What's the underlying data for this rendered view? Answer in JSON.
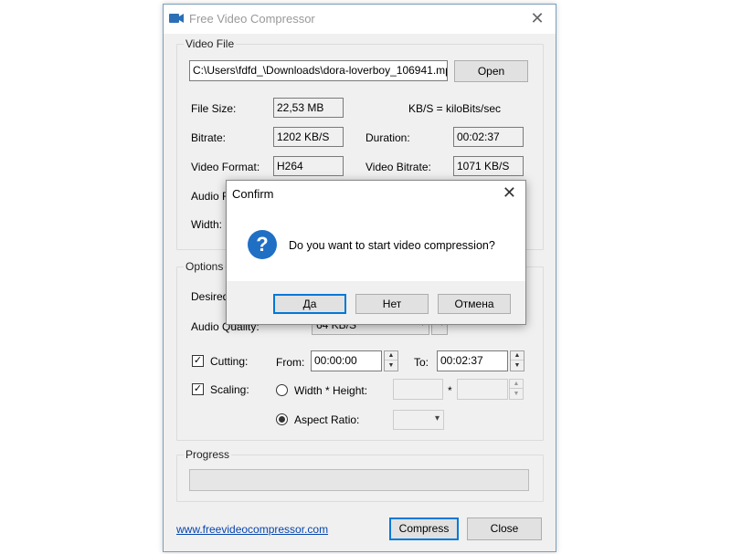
{
  "window": {
    "title": "Free Video Compressor",
    "close_glyph": "✕"
  },
  "video_file": {
    "group_label": "Video File",
    "path_value": "C:\\Users\\fdfd_\\Downloads\\dora-loverboy_106941.mp",
    "open_label": "Open",
    "file_size_label": "File Size:",
    "file_size_value": "22,53 MB",
    "units_note": "KB/S = kiloBits/sec",
    "bitrate_label": "Bitrate:",
    "bitrate_value": "1202 KB/S",
    "duration_label": "Duration:",
    "duration_value": "00:02:37",
    "video_format_label": "Video Format:",
    "video_format_value": "H264",
    "video_bitrate_label": "Video Bitrate:",
    "video_bitrate_value": "1071 KB/S",
    "audio_label_partial": "Audio F",
    "width_label": "Width:"
  },
  "options": {
    "group_label": "Options",
    "desired_label_partial": "Desired",
    "audio_quality_label": "Audio Quality:",
    "audio_quality_value": "64 KB/S",
    "cutting_label": "Cutting:",
    "cutting_checked": "✓",
    "from_label": "From:",
    "from_value": "00:00:00",
    "to_label": "To:",
    "to_value": "00:02:37",
    "scaling_label": "Scaling:",
    "scaling_checked": "✓",
    "width_height_label": "Width * Height:",
    "times_sign": "*",
    "aspect_ratio_label": "Aspect Ratio:"
  },
  "progress": {
    "group_label": "Progress",
    "value": 0
  },
  "footer": {
    "link_text": "www.freevideocompressor.com",
    "compress_label": "Compress",
    "close_label": "Close"
  },
  "dialog": {
    "title": "Confirm",
    "close_glyph": "✕",
    "icon_glyph": "?",
    "message": "Do you want to start video compression?",
    "yes_label": "Да",
    "no_label": "Нет",
    "cancel_label": "Отмена"
  },
  "colors": {
    "accent": "#0078d7",
    "question_icon": "#1f6fc5",
    "link": "#0645ad"
  }
}
